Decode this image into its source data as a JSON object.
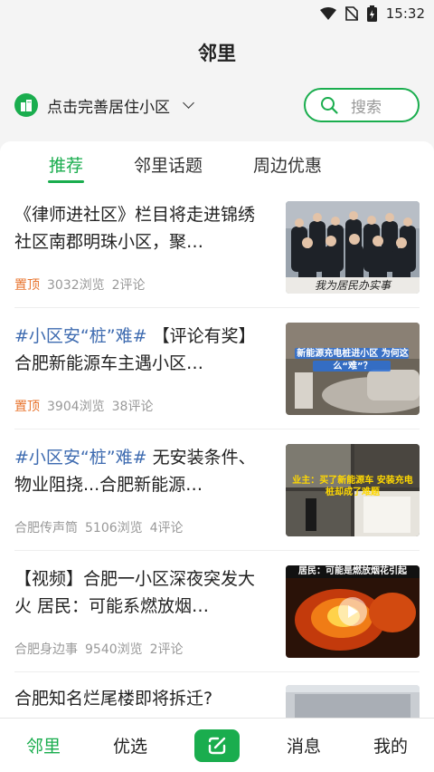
{
  "status_bar": {
    "time": "15:32"
  },
  "header": {
    "title": "邻里"
  },
  "location": {
    "label": "点击完善居住小区"
  },
  "search": {
    "placeholder": "搜索"
  },
  "tabs": [
    {
      "label": "推荐",
      "active": true
    },
    {
      "label": "邻里话题",
      "active": false
    },
    {
      "label": "周边优惠",
      "active": false
    }
  ],
  "news": [
    {
      "topic": "",
      "title": "《律师进社区》栏目将走进锦绣社区南郡明珠小区，聚…",
      "tag": "置顶",
      "source": "",
      "views": "3032浏览",
      "comments": "2评论",
      "thumb_caption": "我为居民办实事"
    },
    {
      "topic": "#小区安“桩”难#",
      "title": " 【评论有奖】合肥新能源车主遇小区…",
      "tag": "置顶",
      "source": "",
      "views": "3904浏览",
      "comments": "38评论",
      "thumb_caption": "新能源充电桩进小区 为何这么“难”？"
    },
    {
      "topic": "#小区安“桩”难#",
      "title": " 无安装条件、物业阻挠...合肥新能源…",
      "tag": "",
      "source": "合肥传声筒",
      "views": "5106浏览",
      "comments": "4评论",
      "thumb_caption": "业主：买了新能源车 安装充电桩却成了难题"
    },
    {
      "topic": "",
      "title": "【视频】合肥一小区深夜突发大火 居民：可能系燃放烟…",
      "tag": "",
      "source": "合肥身边事",
      "views": "9540浏览",
      "comments": "2评论",
      "thumb_caption": "居民：可能是燃放烟花引起"
    },
    {
      "topic": "",
      "title": "合肥知名烂尾楼即将拆迁?",
      "tag": "",
      "source": "",
      "views": "",
      "comments": "",
      "thumb_caption": ""
    }
  ],
  "bottom_nav": {
    "home": "邻里",
    "featured": "优选",
    "messages": "消息",
    "mine": "我的"
  },
  "colors": {
    "accent": "#1aad4e",
    "pin": "#e8742e",
    "topic": "#3e6bb0"
  }
}
